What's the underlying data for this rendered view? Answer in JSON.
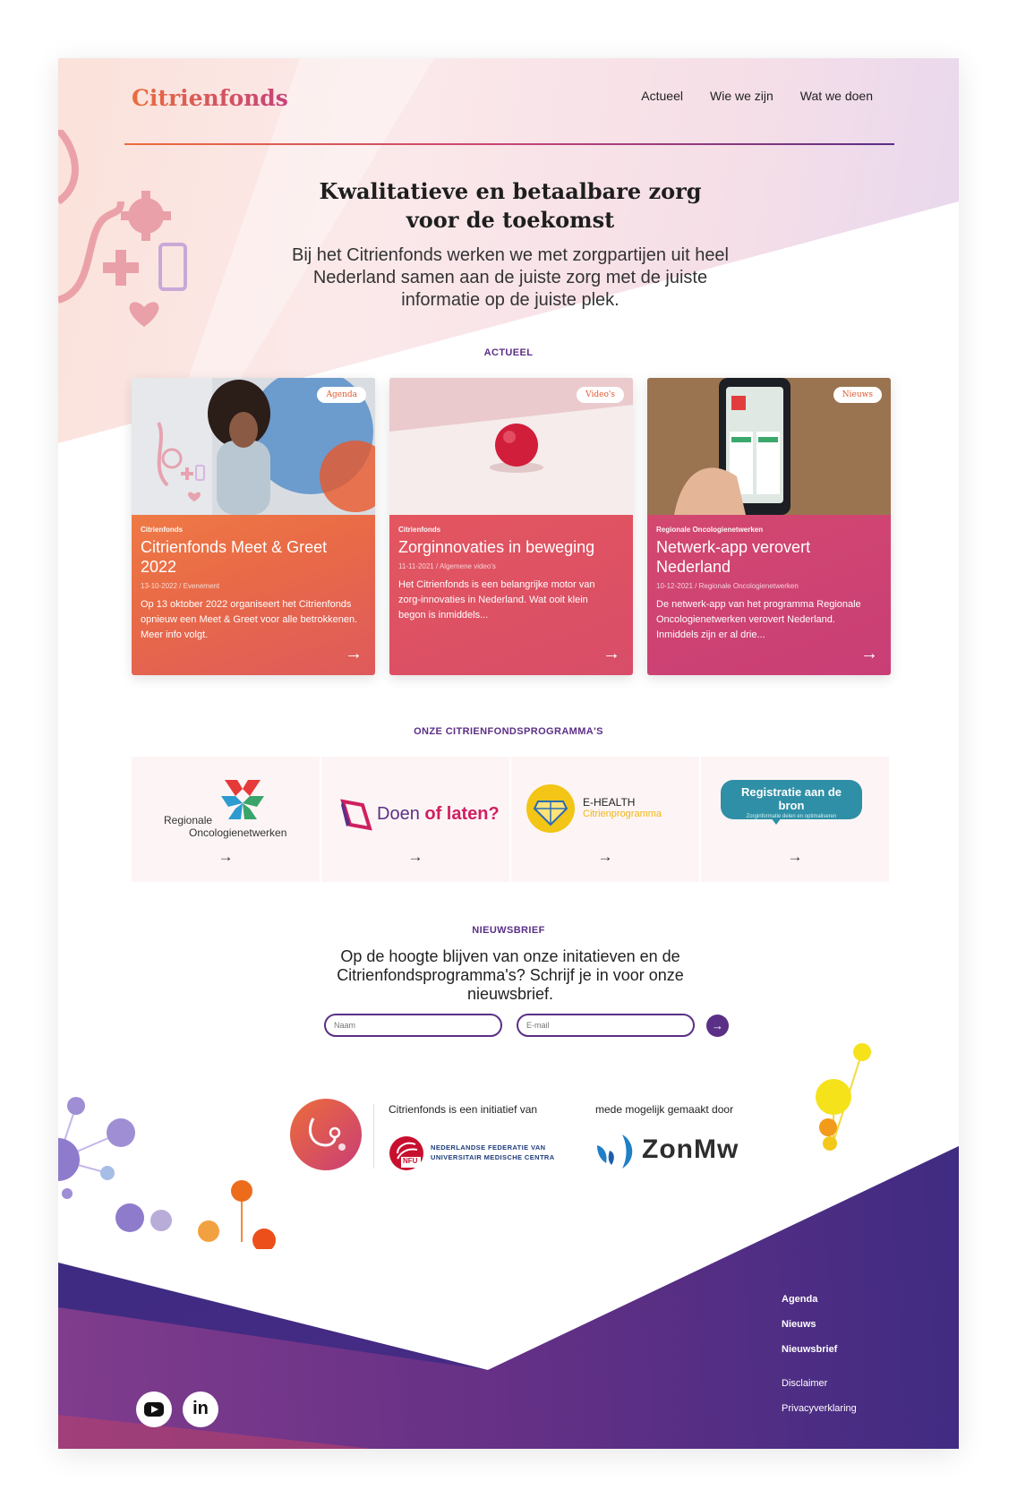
{
  "header": {
    "logo": "Citrienfonds",
    "nav": [
      "Actueel",
      "Wie we zijn",
      "Wat we doen"
    ]
  },
  "hero": {
    "title_line1": "Kwalitatieve en betaalbare zorg",
    "title_line2": "voor de toekomst",
    "subtitle": "Bij het Citrienfonds werken we met zorgpartijen uit heel Nederland samen aan de juiste zorg met de juiste informatie op de juiste plek."
  },
  "actueel": {
    "label": "ACTUEEL",
    "cards": [
      {
        "tag": "Agenda",
        "kicker": "Citrienfonds",
        "title": "Citrienfonds Meet & Greet 2022",
        "meta": "13-10-2022 / Evenement",
        "text": "Op 13 oktober 2022 organiseert het Citrienfonds opnieuw een Meet & Greet voor alle betrokkenen. Meer info volgt."
      },
      {
        "tag": "Video's",
        "kicker": "Citrienfonds",
        "title": "Zorginnovaties in beweging",
        "meta": "11-11-2021 / Algemene video's",
        "text": "Het Citrienfonds is een belangrijke motor van zorg-innovaties in Nederland. Wat ooit klein begon is inmiddels..."
      },
      {
        "tag": "Nieuws",
        "kicker": "Regionale Oncologienetwerken",
        "title": "Netwerk-app verovert Nederland",
        "meta": "10-12-2021 / Regionale Oncologienetwerken",
        "text": "De netwerk-app van het programma Regionale Oncologienetwerken verovert Nederland. Inmiddels zijn er al drie..."
      }
    ]
  },
  "programmas": {
    "label": "ONZE CITRIENFONDSPROGRAMMA'S",
    "items": [
      {
        "line1": "Regionale",
        "line2": "Oncologienetwerken"
      },
      {
        "part1": "Doen ",
        "part2": "of laten?"
      },
      {
        "line1": "E-HEALTH",
        "line2": "Citrienprogramma"
      },
      {
        "line1": "Registratie aan de bron",
        "line2": "Zorginformatie delen en optimaliseren"
      }
    ],
    "arrow": "→"
  },
  "nieuwsbrief": {
    "label": "NIEUWSBRIEF",
    "text": "Op de hoogte blijven van onze initatieven en de Citrienfondsprogramma's? Schrijf je in voor onze nieuwsbrief.",
    "name_placeholder": "Naam",
    "email_placeholder": "E-mail",
    "submit": "→"
  },
  "partners": {
    "initiatief_label": "Citrienfonds is een initiatief van",
    "nfu_line1": "NEDERLANDSE FEDERATIE VAN",
    "nfu_line2": "UNIVERSITAIR MEDISCHE CENTRA",
    "nfu_abbr": "NFU",
    "mogelijk_label": "mede mogelijk gemaakt door",
    "zonmw": "ZonMw"
  },
  "footer": {
    "links_primary": [
      "Agenda",
      "Nieuws",
      "Nieuwsbrief"
    ],
    "links_secondary": [
      "Disclaimer",
      "Privacyverklaring"
    ],
    "social": [
      "youtube-icon",
      "linkedin-icon"
    ],
    "linkedin_text": "in"
  },
  "colors": {
    "purple": "#5b2f86",
    "orange": "#ec6c3b",
    "pink": "#c93e76",
    "footer_dark": "#3d2a7c"
  }
}
